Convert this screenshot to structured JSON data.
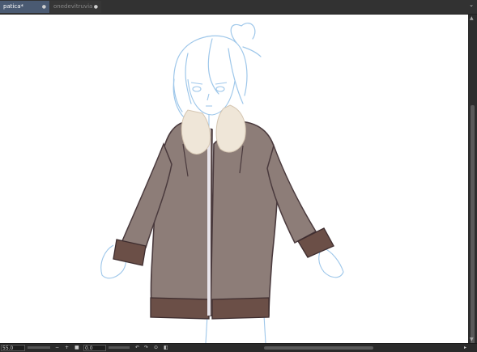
{
  "tabs": [
    {
      "label": "patica*",
      "close_icon": "close-icon",
      "active": true
    },
    {
      "label": "onedevitruvian",
      "close_icon": "close-icon",
      "active": false
    }
  ],
  "tab_menu_icon": "chevron-down-icon",
  "statusbar": {
    "zoom_value": "55.0",
    "zoom_out_icon": "minus-icon",
    "zoom_in_icon": "plus-icon",
    "fit_icon": "square-icon",
    "rotation_value": "0.0",
    "undo_icon": "rotate-left-icon",
    "redo_icon": "rotate-right-icon",
    "reset_rotation_icon": "reset-icon",
    "mirror_icon": "mirror-icon"
  },
  "colors": {
    "tab_active_bg": "#4a5a72",
    "canvas_bg": "#ffffff",
    "sketch_lines": "#9ec7ea",
    "coat": "#8d7d78",
    "coat_outline": "#4a3a3d",
    "fur": "#efe6d8",
    "cuffs": "#6b4f47"
  }
}
